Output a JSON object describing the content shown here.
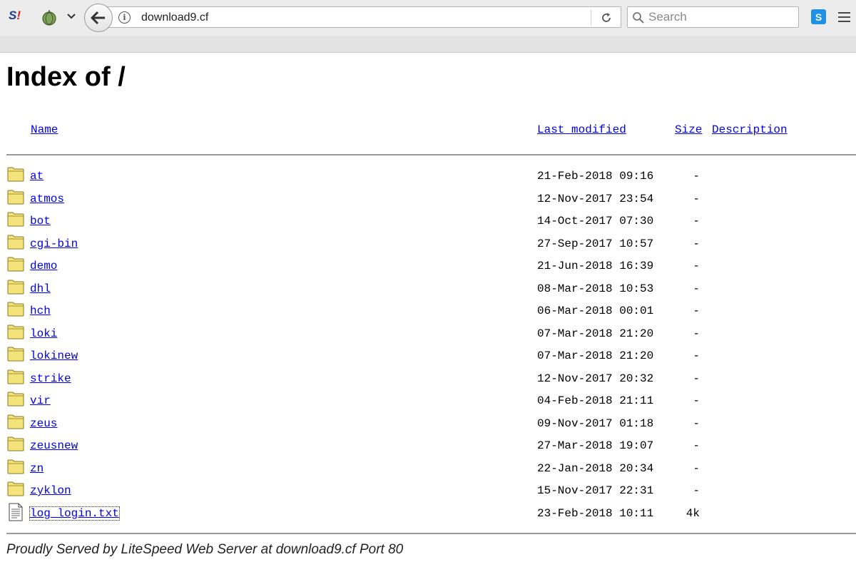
{
  "browser": {
    "url": "download9.cf",
    "search_placeholder": "Search",
    "ext_s_label": "S",
    "ext_s_mark": "!",
    "ext_skype_label": "S"
  },
  "page": {
    "title": "Index of /",
    "columns": {
      "name": "Name",
      "last_modified": "Last modified",
      "size": "Size",
      "description": "Description"
    },
    "entries": [
      {
        "name": "at",
        "modified": "21-Feb-2018 09:16",
        "size": "-",
        "icon": "folder-icon"
      },
      {
        "name": "atmos",
        "modified": "12-Nov-2017 23:54",
        "size": "-",
        "icon": "folder-icon"
      },
      {
        "name": "bot",
        "modified": "14-Oct-2017 07:30",
        "size": "-",
        "icon": "folder-icon"
      },
      {
        "name": "cgi-bin",
        "modified": "27-Sep-2017 10:57",
        "size": "-",
        "icon": "folder-icon"
      },
      {
        "name": "demo",
        "modified": "21-Jun-2018 16:39",
        "size": "-",
        "icon": "folder-icon"
      },
      {
        "name": "dhl",
        "modified": "08-Mar-2018 10:53",
        "size": "-",
        "icon": "folder-icon"
      },
      {
        "name": "hch",
        "modified": "06-Mar-2018 00:01",
        "size": "-",
        "icon": "folder-icon"
      },
      {
        "name": "loki",
        "modified": "07-Mar-2018 21:20",
        "size": "-",
        "icon": "folder-icon"
      },
      {
        "name": "lokinew",
        "modified": "07-Mar-2018 21:20",
        "size": "-",
        "icon": "folder-icon"
      },
      {
        "name": "strike",
        "modified": "12-Nov-2017 20:32",
        "size": "-",
        "icon": "folder-icon"
      },
      {
        "name": "vir",
        "modified": "04-Feb-2018 21:11",
        "size": "-",
        "icon": "folder-icon"
      },
      {
        "name": "zeus",
        "modified": "09-Nov-2017 01:18",
        "size": "-",
        "icon": "folder-icon"
      },
      {
        "name": "zeusnew",
        "modified": "27-Mar-2018 19:07",
        "size": "-",
        "icon": "folder-icon"
      },
      {
        "name": "zn",
        "modified": "22-Jan-2018 20:34",
        "size": "-",
        "icon": "folder-icon"
      },
      {
        "name": "zyklon",
        "modified": "15-Nov-2017 22:31",
        "size": "-",
        "icon": "folder-icon"
      },
      {
        "name": "log_login.txt",
        "modified": "23-Feb-2018 10:11",
        "size": "4k",
        "icon": "text-file-icon"
      }
    ],
    "footer": "Proudly Served by LiteSpeed Web Server at download9.cf Port 80"
  },
  "colors": {
    "link": "#0000ee",
    "folder_fill": "#f3e37a",
    "folder_stroke": "#8a7a20"
  }
}
